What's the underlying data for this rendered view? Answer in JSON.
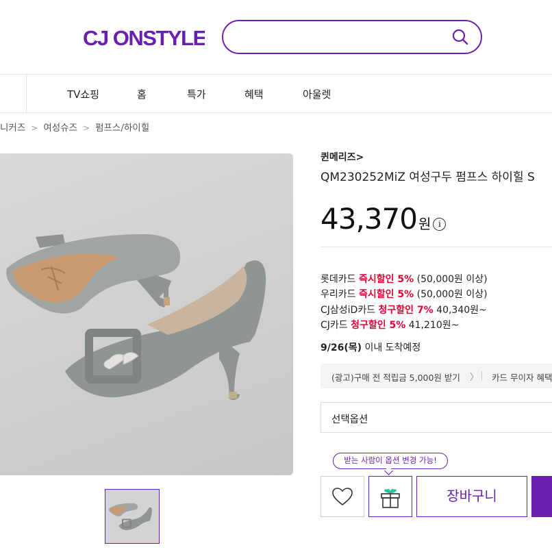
{
  "header": {
    "logo_text": "CJ ONSTYLE",
    "search": {
      "value": "",
      "placeholder": ""
    }
  },
  "nav": {
    "items": [
      "TV쇼핑",
      "홈",
      "특가",
      "혜택",
      "아울렛"
    ]
  },
  "breadcrumb": [
    "니커즈",
    "여성슈즈",
    "펌프스/하이힐"
  ],
  "product": {
    "brand": "퀸메리즈>",
    "title": "QM230252MiZ 여성구두 펌프스 하이힐 S",
    "price": "43,370",
    "price_unit": "원",
    "info_icon": "i",
    "cards": [
      {
        "name": "롯데카드 ",
        "highlight": "즉시할인 5%",
        "rest": " (50,000원 이상)"
      },
      {
        "name": "우리카드 ",
        "highlight": "즉시할인 5%",
        "rest": " (50,000원 이상)"
      },
      {
        "name": "CJ삼성iD카드 ",
        "highlight": "청구할인 7%",
        "rest": " 40,340원~"
      },
      {
        "name": "CJ카드 ",
        "highlight": "청구할인 5%",
        "rest": " 41,210원~"
      }
    ],
    "delivery_date": "9/26(목)",
    "delivery_text": " 이내 도착예정",
    "benefit_1": "(광고)구매 전 적립금 5,000원 받기",
    "benefit_chevron": "〉",
    "benefit_2": "카드 무이자 혜택",
    "option_label": "선택옵션",
    "gift_tooltip": "받는 사람이 옵션 변경 가능!",
    "cart_label": "장바구니"
  },
  "colors": {
    "brand_purple": "#6b1fb1",
    "discount_red": "#e60033",
    "gift_green": "#22c5a0"
  },
  "icons": {
    "search": "search-icon",
    "like": "heart-icon",
    "gift": "gift-icon",
    "info": "info-icon"
  }
}
